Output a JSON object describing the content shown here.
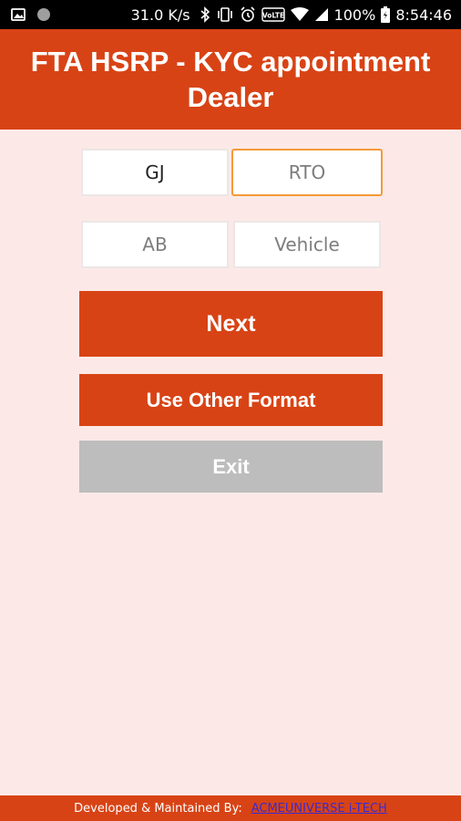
{
  "status_bar": {
    "speed": "31.0 K/s",
    "network_badge": "VoLTE",
    "battery": "100%",
    "time": "8:54:46",
    "icons": [
      "image-icon",
      "circle-icon",
      "bluetooth-icon",
      "vibrate-icon",
      "alarm-icon",
      "volte-icon",
      "wifi-icon",
      "signal-icon",
      "battery-icon"
    ]
  },
  "header": {
    "title": "FTA HSRP - KYC appointment Dealer"
  },
  "form": {
    "state": {
      "value": "GJ"
    },
    "rto": {
      "placeholder": "RTO"
    },
    "series": {
      "placeholder": "AB"
    },
    "vehicle": {
      "placeholder": "Vehicle"
    }
  },
  "buttons": {
    "next": "Next",
    "other_format": "Use Other Format",
    "exit": "Exit"
  },
  "footer": {
    "label": "Developed & Maintained By:",
    "link": "ACMEUNIVERSE i-TECH"
  },
  "colors": {
    "primary": "#d84315",
    "background": "#fce9e7",
    "disabled": "#bdbdbd",
    "focus": "#f29b38",
    "link": "#3a2bd1"
  }
}
